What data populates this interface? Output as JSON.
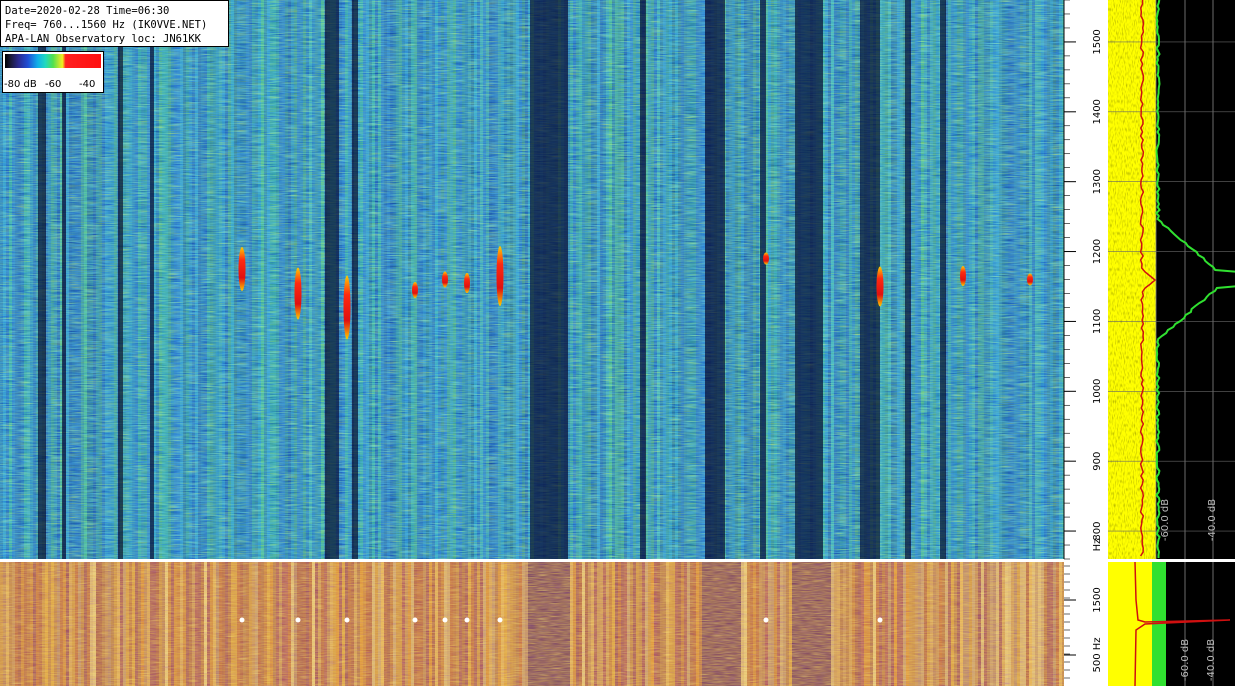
{
  "info": {
    "date_line": "Date=2020-02-28 Time=06:30",
    "freq_line": "Freq= 760...1560 Hz (IK0VVE.NET)",
    "obs_line": "APA-LAN Observatory loc: JN61KK"
  },
  "colorbar": {
    "labels": [
      "-80 dB",
      "-60",
      "-40"
    ]
  },
  "chart_data": [
    {
      "type": "heatmap",
      "title": "",
      "ylabel": "Hz",
      "ylim": [
        760,
        1560
      ],
      "yticks": [
        "800",
        "900",
        "1000",
        "1100",
        "1200",
        "1300",
        "1400",
        "1500"
      ],
      "yunit_label": "Hz",
      "colorscale": "rainbow",
      "echoes": [
        {
          "x": 242,
          "freq": 1175
        },
        {
          "x": 298,
          "freq": 1140
        },
        {
          "x": 347,
          "freq": 1120
        },
        {
          "x": 415,
          "freq": 1145
        },
        {
          "x": 445,
          "freq": 1160
        },
        {
          "x": 467,
          "freq": 1155
        },
        {
          "x": 500,
          "freq": 1165
        },
        {
          "x": 766,
          "freq": 1190
        },
        {
          "x": 880,
          "freq": 1150
        },
        {
          "x": 963,
          "freq": 1165
        },
        {
          "x": 1030,
          "freq": 1160
        }
      ]
    },
    {
      "type": "line",
      "title": "",
      "xlabel": "dB",
      "xticks": [
        "-60.0 dB",
        "-40.0 dB"
      ],
      "series": [],
      "peak_freq": 1160
    },
    {
      "type": "heatmap",
      "title": "",
      "ylabel": "Hz",
      "yticks": [
        "1500",
        "500 Hz"
      ],
      "colorscale": "inferno"
    },
    {
      "type": "line",
      "title": "",
      "xticks": [
        "-60.0 dB",
        "-40.0 dB"
      ],
      "series": []
    }
  ]
}
